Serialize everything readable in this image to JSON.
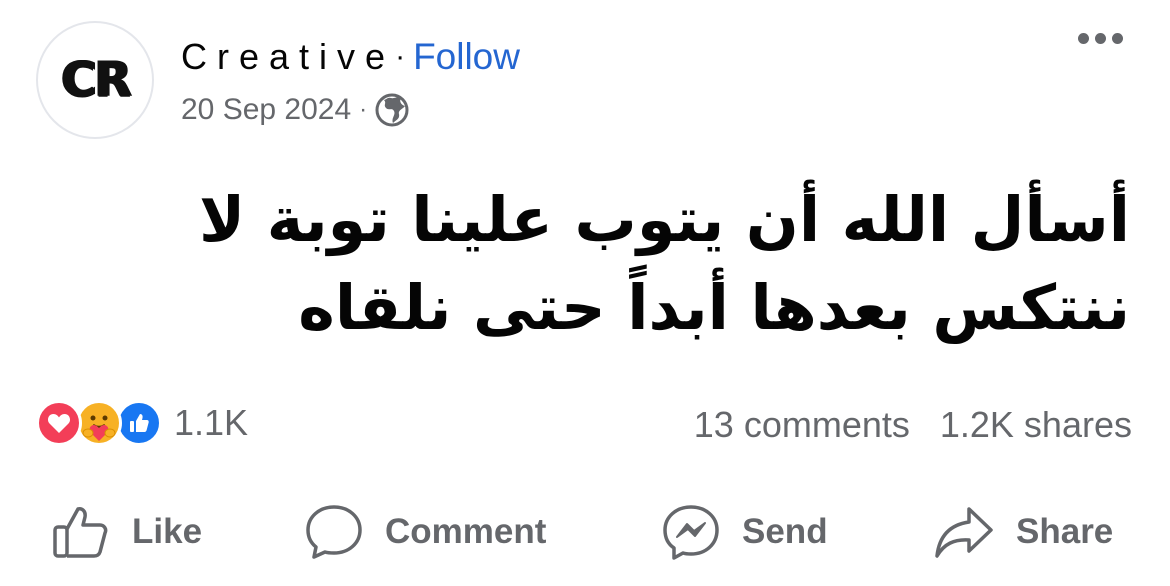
{
  "header": {
    "avatar_text": "CR",
    "page_name": "Creative",
    "separator": "·",
    "follow_label": "Follow",
    "date": "20 Sep 2024",
    "meta_separator": "·",
    "privacy_icon": "globe-icon",
    "more_icon": "more-options-icon"
  },
  "post": {
    "lines": [
      "أسأل الله أن يتوب علينا توبة لا",
      "ننتكس بعدها أبداً حتى نلقاه"
    ]
  },
  "engagement": {
    "reaction_icons": [
      "love-reaction-icon",
      "care-reaction-icon",
      "like-reaction-icon"
    ],
    "reaction_count": "1.1K",
    "comments": "13 comments",
    "shares": "1.2K shares"
  },
  "actions": {
    "like": "Like",
    "comment": "Comment",
    "send": "Send",
    "share": "Share"
  },
  "colors": {
    "follow": "#2466d1",
    "secondary_text": "#65676b",
    "love": "#f33e58",
    "like": "#1877f2",
    "care": "#f7b125"
  }
}
